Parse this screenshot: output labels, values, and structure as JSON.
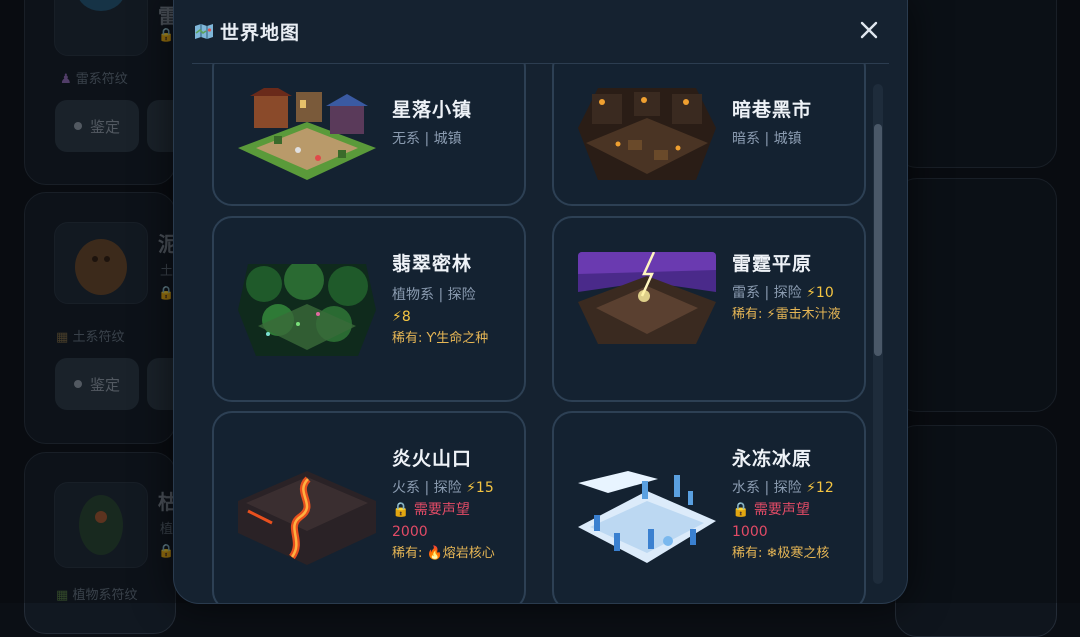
{
  "background": {
    "monsters": [
      {
        "title": "雷",
        "sub_label": "雷系符纹",
        "action_label": "鉴定"
      },
      {
        "title": "泥",
        "sub_prefix": "土",
        "sub_label": "土系符纹",
        "action_label": "鉴定"
      },
      {
        "title": "枯",
        "sub_prefix": "植",
        "sub_label": "植物系符纹"
      }
    ]
  },
  "modal": {
    "title": "世界地图",
    "icons": {
      "title_icon": "map-icon",
      "close_icon": "close-icon"
    },
    "locations": [
      {
        "name": "星落小镇",
        "meta": "无系 | 城镇"
      },
      {
        "name": "暗巷黑市",
        "meta": "暗系 | 城镇"
      },
      {
        "name": "翡翠密林",
        "meta": "植物系 | 探险",
        "energy": "⚡8",
        "rare_label": "稀有:",
        "rare_item": "Ƴ生命之种"
      },
      {
        "name": "雷霆平原",
        "meta": "雷系 | 探险",
        "energy": "⚡10",
        "rare_label": "稀有:",
        "rare_item": "⚡雷击木汁液"
      },
      {
        "name": "炎火山口",
        "meta": "火系 | 探险",
        "energy": "⚡15",
        "lock_label": "需要声望",
        "lock_value": "2000",
        "rare_label": "稀有:",
        "rare_item": "🔥熔岩核心"
      },
      {
        "name": "永冻冰原",
        "meta": "水系 | 探险",
        "energy": "⚡12",
        "lock_label": "需要声望",
        "lock_value": "1000",
        "rare_label": "稀有:",
        "rare_item": "❄极寒之核"
      }
    ]
  },
  "colors": {
    "modal_bg": "#152230",
    "card_border": "#2d4054",
    "energy": "#f5c542",
    "lock_text": "#e24b66",
    "rare_text": "#e6b655"
  }
}
